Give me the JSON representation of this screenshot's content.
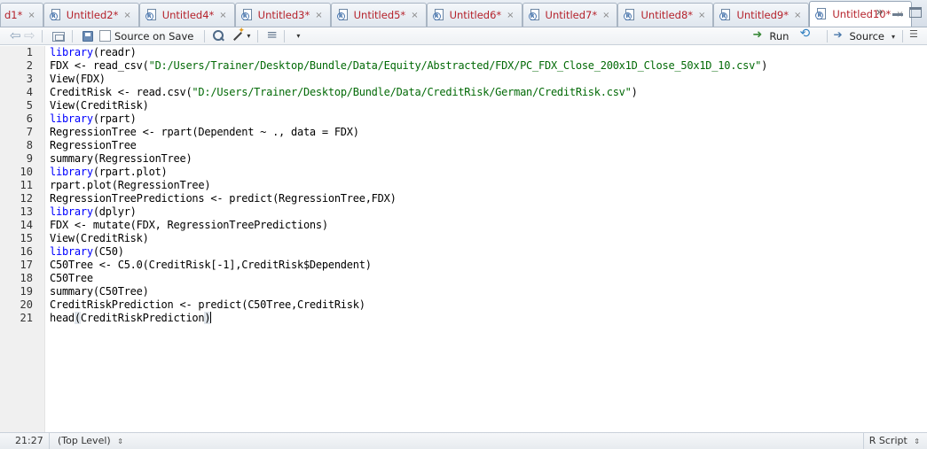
{
  "tabs": [
    {
      "label": "d1*",
      "close": "×"
    },
    {
      "label": "Untitled2*",
      "close": "×"
    },
    {
      "label": "Untitled4*",
      "close": "×"
    },
    {
      "label": "Untitled3*",
      "close": "×"
    },
    {
      "label": "Untitled5*",
      "close": "×"
    },
    {
      "label": "Untitled6*",
      "close": "×"
    },
    {
      "label": "Untitled7*",
      "close": "×"
    },
    {
      "label": "Untitled8*",
      "close": "×"
    },
    {
      "label": "Untitled9*",
      "close": "×"
    },
    {
      "label": "Untitled10*",
      "close": "×"
    }
  ],
  "tabbar": {
    "overflow": "»"
  },
  "toolbar": {
    "source_on_save": "Source on Save",
    "run": "Run",
    "source": "Source",
    "caret": "▾"
  },
  "editor": {
    "line_numbers": [
      "1",
      "2",
      "3",
      "4",
      "5",
      "6",
      "7",
      "8",
      "9",
      "10",
      "11",
      "12",
      "13",
      "14",
      "15",
      "16",
      "17",
      "18",
      "19",
      "20",
      "21"
    ],
    "lines": [
      [
        {
          "t": "library",
          "c": "kw"
        },
        {
          "t": "(readr)"
        }
      ],
      [
        {
          "t": "FDX <- read_csv("
        },
        {
          "t": "\"D:/Users/Trainer/Desktop/Bundle/Data/Equity/Abstracted/FDX/PC_FDX_Close_200x1D_Close_50x1D_10.csv\"",
          "c": "str"
        },
        {
          "t": ")"
        }
      ],
      [
        {
          "t": "View(FDX)"
        }
      ],
      [
        {
          "t": "CreditRisk <- read.csv("
        },
        {
          "t": "\"D:/Users/Trainer/Desktop/Bundle/Data/CreditRisk/German/CreditRisk.csv\"",
          "c": "str"
        },
        {
          "t": ")"
        }
      ],
      [
        {
          "t": "View(CreditRisk)"
        }
      ],
      [
        {
          "t": "library",
          "c": "kw"
        },
        {
          "t": "(rpart)"
        }
      ],
      [
        {
          "t": "RegressionTree <- rpart(Dependent ~ ., data = FDX)"
        }
      ],
      [
        {
          "t": "RegressionTree"
        }
      ],
      [
        {
          "t": "summary(RegressionTree)"
        }
      ],
      [
        {
          "t": "library",
          "c": "kw"
        },
        {
          "t": "(rpart.plot)"
        }
      ],
      [
        {
          "t": "rpart.plot(RegressionTree)"
        }
      ],
      [
        {
          "t": "RegressionTreePredictions <- predict(RegressionTree,FDX)"
        }
      ],
      [
        {
          "t": "library",
          "c": "kw"
        },
        {
          "t": "(dplyr)"
        }
      ],
      [
        {
          "t": "FDX <- mutate(FDX, RegressionTreePredictions)"
        }
      ],
      [
        {
          "t": "View(CreditRisk)"
        }
      ],
      [
        {
          "t": "library",
          "c": "kw"
        },
        {
          "t": "(C50)"
        }
      ],
      [
        {
          "t": "C50Tree <- C5.0(CreditRisk[-1],CreditRisk$Dependent)"
        }
      ],
      [
        {
          "t": "C50Tree"
        }
      ],
      [
        {
          "t": "summary(C50Tree)"
        }
      ],
      [
        {
          "t": "CreditRiskPrediction <- predict(C50Tree,CreditRisk)"
        }
      ],
      [
        {
          "t": "head"
        },
        {
          "t": "(",
          "c": "paren-hl"
        },
        {
          "t": "CreditRiskPrediction"
        },
        {
          "t": ")",
          "c": "paren-hl"
        },
        {
          "t": "",
          "c": "cursor"
        }
      ]
    ]
  },
  "status": {
    "position": "21:27",
    "scope": "(Top Level)",
    "language": "R Script",
    "updown": "⇕"
  }
}
